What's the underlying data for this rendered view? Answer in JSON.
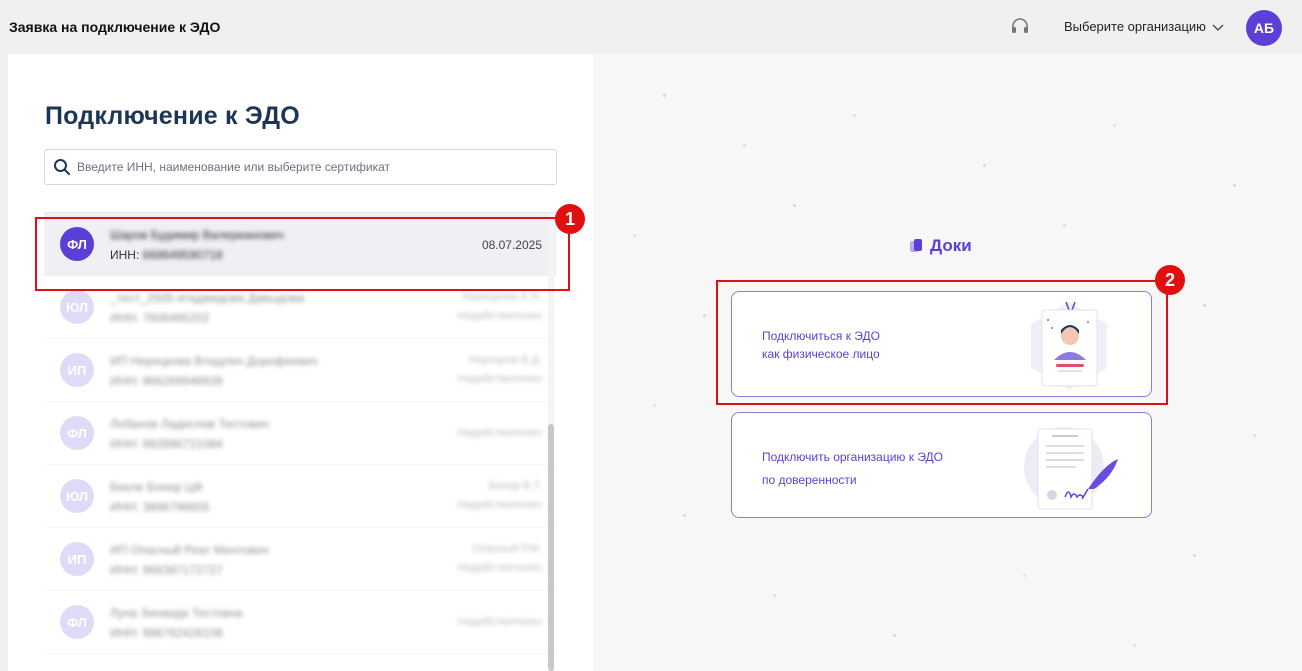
{
  "header": {
    "title": "Заявка на подключение к ЭДО",
    "org_select_label": "Выберите организацию",
    "user_initials": "АБ"
  },
  "left": {
    "page_title": "Подключение к ЭДО",
    "search_placeholder": "Введите ИНН, наименование или выберите сертификат",
    "selected": {
      "badge": "ФЛ",
      "name": "Шаров Будимир Валерианович",
      "inn_label": "ИНН:",
      "inn_value": "668649590718",
      "date": "08.07.2025"
    },
    "rows": [
      {
        "badge": "ЮЛ",
        "name": "_тест_2505-ятаджидова Давыдова",
        "inn": "ИНН: 7606495202",
        "owner": "Нерецкова А.Н.",
        "status": "Недействителен"
      },
      {
        "badge": "ИП",
        "name": "ИП Нерецкова Владлен Дорофеевич",
        "inn": "ИНН: 966269948839",
        "owner": "Нерецков В.Д.",
        "status": "Недействителен"
      },
      {
        "badge": "ФЛ",
        "name": "Лобанов Ладислав Тестович",
        "inn": "ИНН: 992896721084",
        "owner": "",
        "status": "Недействителен"
      },
      {
        "badge": "ЮЛ",
        "name": "Бекле Бонер ЦФ",
        "inn": "ИНН: 3896796655",
        "owner": "Бонер В.Т.",
        "status": "Недействителен"
      },
      {
        "badge": "ИП",
        "name": "ИП Опасный Реат Ментович",
        "inn": "ИНН: 966387172727",
        "owner": "Опасный Р.М.",
        "status": "Недействителен"
      },
      {
        "badge": "ФЛ",
        "name": "Луна Зинаида Тестовна",
        "inn": "ИНН: 996762428108",
        "owner": "",
        "status": "Недействителен"
      }
    ]
  },
  "right": {
    "brand": "Доки",
    "card1": {
      "line1": "Подключиться к ЭДО",
      "line2": "как физическое лицо"
    },
    "card2": {
      "line1": "Подключить организацию к ЭДО",
      "line2": "по доверенности"
    }
  },
  "annotations": {
    "one": "1",
    "two": "2"
  },
  "colors": {
    "accent": "#5b3fd6",
    "annotation": "#e01010",
    "badge_dim": "#c9bdf2"
  },
  "icons": {
    "support": "headset-icon",
    "search": "search-icon",
    "chevron": "chevron-down-icon",
    "brand": "doki-logo-icon"
  }
}
